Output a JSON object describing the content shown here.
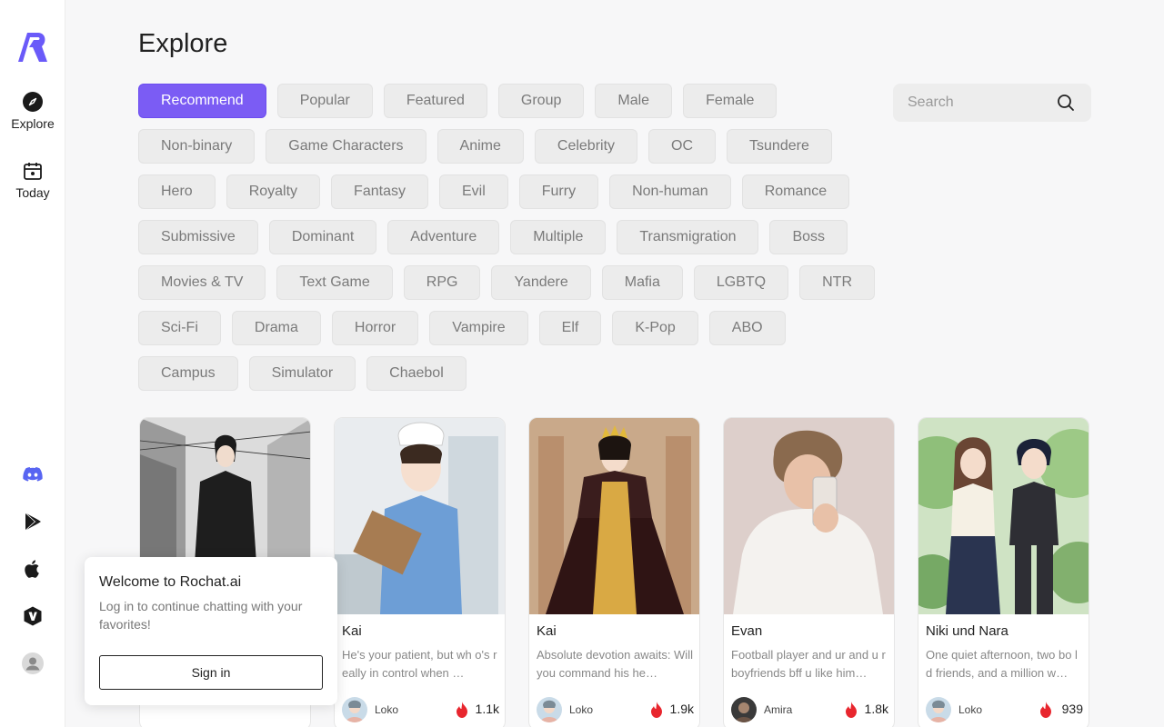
{
  "sidebar": {
    "nav": [
      {
        "label": "Explore",
        "icon": "compass-icon"
      },
      {
        "label": "Today",
        "icon": "calendar-icon"
      }
    ],
    "bottom_icons": [
      "discord-icon",
      "google-play-icon",
      "apple-icon",
      "shield-v-icon",
      "user-avatar-icon"
    ]
  },
  "page": {
    "title": "Explore"
  },
  "search": {
    "placeholder": "Search"
  },
  "tags": [
    "Recommend",
    "Popular",
    "Featured",
    "Group",
    "Male",
    "Female",
    "Non-binary",
    "Game Characters",
    "Anime",
    "Celebrity",
    "OC",
    "Tsundere",
    "Hero",
    "Royalty",
    "Fantasy",
    "Evil",
    "Furry",
    "Non-human",
    "Romance",
    "Submissive",
    "Dominant",
    "Adventure",
    "Multiple",
    "Transmigration",
    "Boss",
    "Movies & TV",
    "Text Game",
    "RPG",
    "Yandere",
    "Mafia",
    "LGBTQ",
    "NTR",
    "Sci-Fi",
    "Drama",
    "Horror",
    "Vampire",
    "Elf",
    "K-Pop",
    "ABO",
    "Campus",
    "Simulator",
    "Chaebol"
  ],
  "active_tag": "Recommend",
  "cards": [
    {
      "name": "",
      "desc": "",
      "creator": "",
      "count": ""
    },
    {
      "name": "Kai",
      "desc": "He's your patient, but wh o's really in control when …",
      "creator": "Loko",
      "count": "1.1k"
    },
    {
      "name": "Kai",
      "desc": "Absolute devotion awaits: Will you command his he…",
      "creator": "Loko",
      "count": "1.9k"
    },
    {
      "name": "Evan",
      "desc": "Football player and ur and u r boyfriends bff u like him…",
      "creator": "Amira",
      "count": "1.8k"
    },
    {
      "name": "Niki und Nara",
      "desc": "One quiet afternoon, two bo ld friends, and a million w…",
      "creator": "Loko",
      "count": "939"
    }
  ],
  "popup": {
    "title": "Welcome to Rochat.ai",
    "text": "Log in to continue chatting with your favorites!",
    "button": "Sign in"
  },
  "colors": {
    "accent": "#7b5cf4",
    "fire": "#e8262e",
    "discord": "#5865f2"
  }
}
